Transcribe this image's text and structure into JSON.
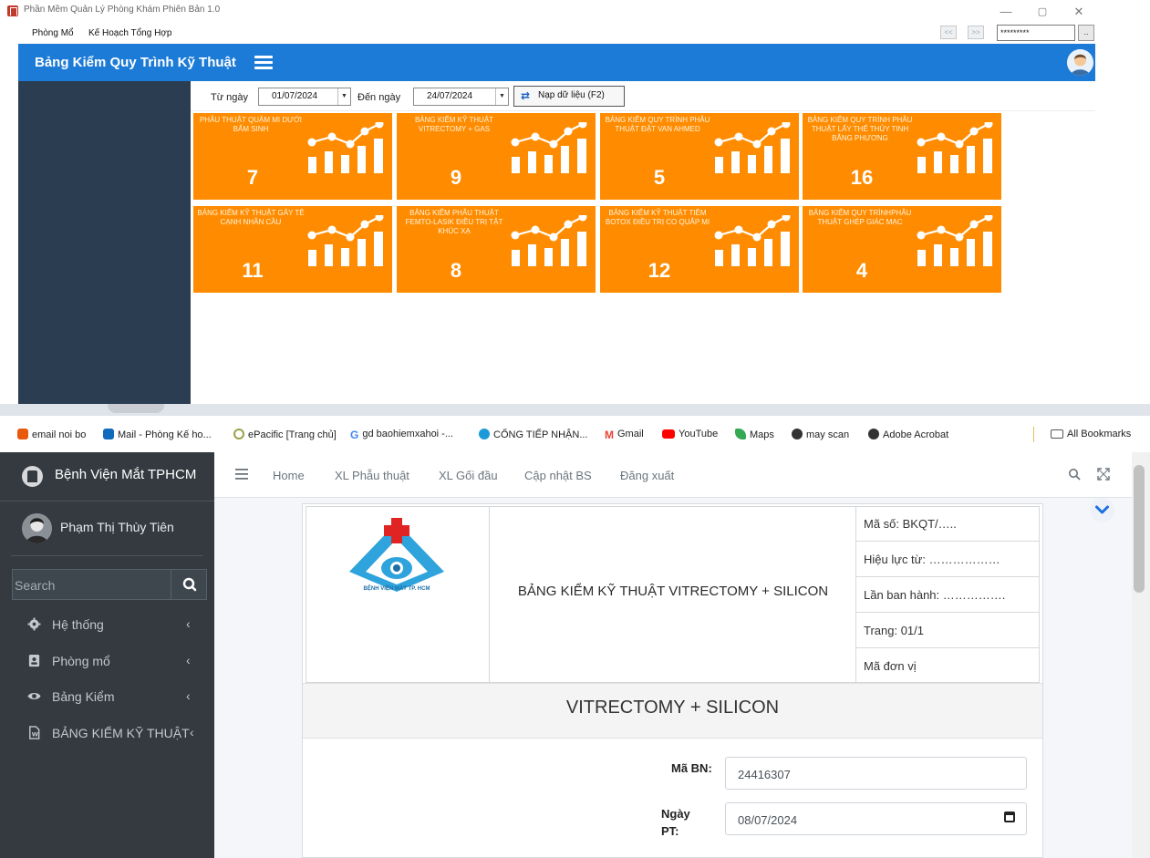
{
  "desktop_app": {
    "window_title": "Phần Mềm Quản Lý Phòng Khám Phiên Bản 1.0",
    "window_controls": [
      "—",
      "▢",
      "✕"
    ],
    "menu": [
      "Phòng Mổ",
      "Kế Hoạch Tổng Hợp"
    ],
    "nav_prev": "<<",
    "nav_next": ">>",
    "password_value": "*********",
    "more_button": "..",
    "header_title": "Bảng Kiểm Quy Trình Kỹ Thuật",
    "filter": {
      "from_label": "Từ ngày",
      "from_value": "01/07/2024",
      "to_label": "Đến ngày",
      "to_value": "24/07/2024",
      "load_button": "Nạp dữ liệu (F2)"
    },
    "tiles": [
      {
        "label": "PHẪU THUẬT QUẶM MI DƯỚI BẨM SINH",
        "count": "7"
      },
      {
        "label": "BẢNG KIỂM KỸ THUẬT VITRECTOMY + GAS",
        "count": "9"
      },
      {
        "label": "BẢNG KIỂM QUY TRÌNH PHẪU THUẬT ĐẶT VAN AHMED",
        "count": "5"
      },
      {
        "label": "BẢNG KIỂM QUY TRÌNH PHẪU THUẬT LẤY THỂ THỦY TINH BẰNG PHƯƠNG",
        "count": "16"
      },
      {
        "label": "BẢNG KIỂM KỸ THUẬT GÂY TÊ CẠNH NHÃN CẦU",
        "count": "11"
      },
      {
        "label": "BẢNG KIỂM PHẪU THUẬT FEMTO-LASIK ĐIỀU TRỊ TẬT KHÚC XẠ",
        "count": "8"
      },
      {
        "label": "BẢNG KIỂM KỸ THUẬT TIÊM BOTOX ĐIỀU TRỊ CO QUẮP MI",
        "count": "12"
      },
      {
        "label": "BẢNG KIỂM QUY TRÌNHPHẪU THUẬT GHÉP GIÁC MẠC",
        "count": "4"
      }
    ],
    "colors": {
      "header": "#1c7bd6",
      "tile": "#ff8c00",
      "sidebar": "#2b3d51"
    }
  },
  "browser": {
    "bookmarks": [
      {
        "label": "email noi bo",
        "icon": "office-icon",
        "color": "#e8590c"
      },
      {
        "label": "Mail - Phòng Kế ho...",
        "icon": "outlook-icon",
        "color": "#0f6cbd"
      },
      {
        "label": "ePacific [Trang chủ]",
        "icon": "epacific-icon",
        "color": "#9aa14a"
      },
      {
        "label": "gd baohiemxahoi -...",
        "icon": "google-icon",
        "color": "#4285f4"
      },
      {
        "label": "CỔNG TIẾP NHẬN...",
        "icon": "portal-icon",
        "color": "#1a9bd7"
      },
      {
        "label": "Gmail",
        "icon": "gmail-icon",
        "color": "#ea4335"
      },
      {
        "label": "YouTube",
        "icon": "youtube-icon",
        "color": "#ff0000"
      },
      {
        "label": "Maps",
        "icon": "maps-icon",
        "color": "#34a853"
      },
      {
        "label": "may scan",
        "icon": "globe-icon",
        "color": "#333333"
      },
      {
        "label": "Adobe Acrobat",
        "icon": "globe-icon",
        "color": "#333333"
      }
    ],
    "all_bookmarks": "All Bookmarks"
  },
  "webapp": {
    "brand": "Bệnh Viện Mắt TPHCM",
    "user_name": "Phạm Thị Thùy Tiên",
    "search_placeholder": "Search",
    "nav": [
      {
        "label": "Hệ thống",
        "icon": "gear-icon"
      },
      {
        "label": "Phòng mổ",
        "icon": "id-card-icon"
      },
      {
        "label": "Bảng Kiểm",
        "icon": "eye-icon"
      },
      {
        "label": "BẢNG KIỂM KỸ THUẬT",
        "icon": "word-file-icon"
      }
    ],
    "top_menu": [
      "Home",
      "XL Phẫu thuật",
      "XL Gối đầu",
      "Cập nhật BS",
      "Đăng xuất"
    ],
    "document": {
      "logo_caption": "BỆNH VIỆN MẮT TP. HCM",
      "title": "BẢNG KIỂM KỸ THUẬT VITRECTOMY + SILICON",
      "meta": [
        "Mã số: BKQT/…..",
        "Hiệu lực từ: ………………",
        "Lần ban hành: …………….",
        "Trang: 01/1",
        "Mã đơn vị"
      ],
      "banner": "VITRECTOMY + SILICON",
      "patient_id_label": "Mã BN:",
      "patient_id_value": "24416307",
      "surgery_date_label_1": "Ngày",
      "surgery_date_label_2": "PT:",
      "surgery_date_value": "08/07/2024"
    }
  }
}
